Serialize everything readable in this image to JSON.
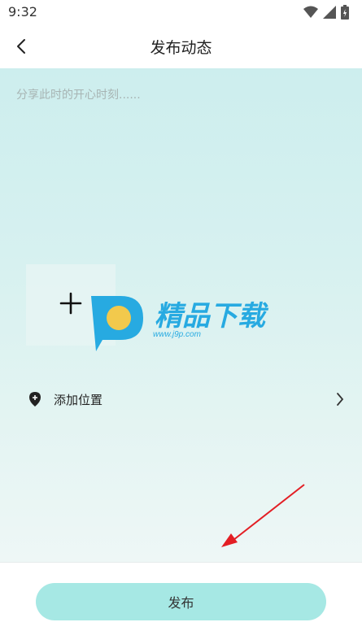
{
  "status_bar": {
    "time": "9:32"
  },
  "nav": {
    "title": "发布动态"
  },
  "composer": {
    "placeholder": "分享此时的开心时刻......"
  },
  "location": {
    "label": "添加位置"
  },
  "watermark": {
    "brand_text": "精品下载",
    "url_text": "www.j9p.com"
  },
  "actions": {
    "publish_label": "发布"
  },
  "colors": {
    "accent": "#a6e8e4",
    "background_top": "#cdeeee",
    "annotation_arrow": "#e31e24"
  }
}
